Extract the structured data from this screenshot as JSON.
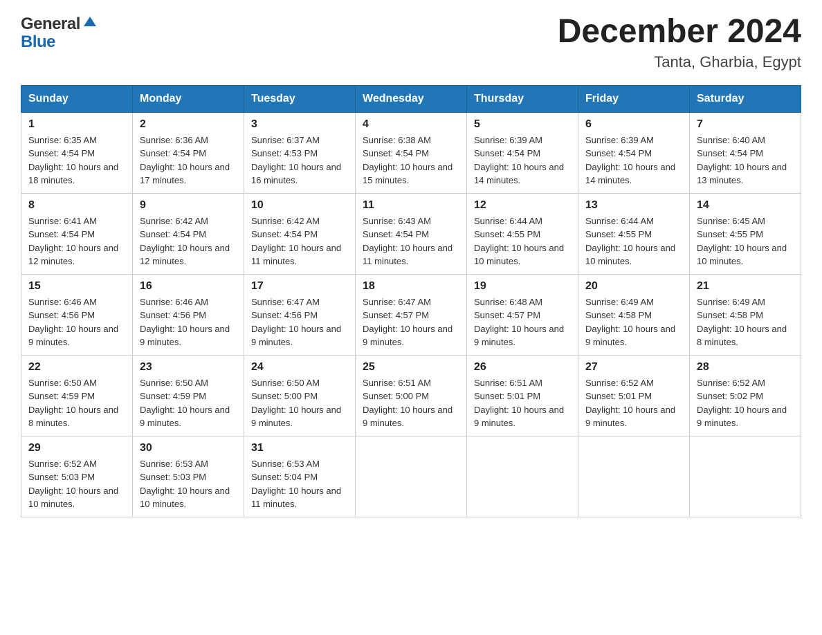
{
  "header": {
    "logo_general": "General",
    "logo_blue": "Blue",
    "month_title": "December 2024",
    "location": "Tanta, Gharbia, Egypt"
  },
  "weekdays": [
    "Sunday",
    "Monday",
    "Tuesday",
    "Wednesday",
    "Thursday",
    "Friday",
    "Saturday"
  ],
  "weeks": [
    [
      {
        "day": "1",
        "sunrise": "Sunrise: 6:35 AM",
        "sunset": "Sunset: 4:54 PM",
        "daylight": "Daylight: 10 hours and 18 minutes."
      },
      {
        "day": "2",
        "sunrise": "Sunrise: 6:36 AM",
        "sunset": "Sunset: 4:54 PM",
        "daylight": "Daylight: 10 hours and 17 minutes."
      },
      {
        "day": "3",
        "sunrise": "Sunrise: 6:37 AM",
        "sunset": "Sunset: 4:53 PM",
        "daylight": "Daylight: 10 hours and 16 minutes."
      },
      {
        "day": "4",
        "sunrise": "Sunrise: 6:38 AM",
        "sunset": "Sunset: 4:54 PM",
        "daylight": "Daylight: 10 hours and 15 minutes."
      },
      {
        "day": "5",
        "sunrise": "Sunrise: 6:39 AM",
        "sunset": "Sunset: 4:54 PM",
        "daylight": "Daylight: 10 hours and 14 minutes."
      },
      {
        "day": "6",
        "sunrise": "Sunrise: 6:39 AM",
        "sunset": "Sunset: 4:54 PM",
        "daylight": "Daylight: 10 hours and 14 minutes."
      },
      {
        "day": "7",
        "sunrise": "Sunrise: 6:40 AM",
        "sunset": "Sunset: 4:54 PM",
        "daylight": "Daylight: 10 hours and 13 minutes."
      }
    ],
    [
      {
        "day": "8",
        "sunrise": "Sunrise: 6:41 AM",
        "sunset": "Sunset: 4:54 PM",
        "daylight": "Daylight: 10 hours and 12 minutes."
      },
      {
        "day": "9",
        "sunrise": "Sunrise: 6:42 AM",
        "sunset": "Sunset: 4:54 PM",
        "daylight": "Daylight: 10 hours and 12 minutes."
      },
      {
        "day": "10",
        "sunrise": "Sunrise: 6:42 AM",
        "sunset": "Sunset: 4:54 PM",
        "daylight": "Daylight: 10 hours and 11 minutes."
      },
      {
        "day": "11",
        "sunrise": "Sunrise: 6:43 AM",
        "sunset": "Sunset: 4:54 PM",
        "daylight": "Daylight: 10 hours and 11 minutes."
      },
      {
        "day": "12",
        "sunrise": "Sunrise: 6:44 AM",
        "sunset": "Sunset: 4:55 PM",
        "daylight": "Daylight: 10 hours and 10 minutes."
      },
      {
        "day": "13",
        "sunrise": "Sunrise: 6:44 AM",
        "sunset": "Sunset: 4:55 PM",
        "daylight": "Daylight: 10 hours and 10 minutes."
      },
      {
        "day": "14",
        "sunrise": "Sunrise: 6:45 AM",
        "sunset": "Sunset: 4:55 PM",
        "daylight": "Daylight: 10 hours and 10 minutes."
      }
    ],
    [
      {
        "day": "15",
        "sunrise": "Sunrise: 6:46 AM",
        "sunset": "Sunset: 4:56 PM",
        "daylight": "Daylight: 10 hours and 9 minutes."
      },
      {
        "day": "16",
        "sunrise": "Sunrise: 6:46 AM",
        "sunset": "Sunset: 4:56 PM",
        "daylight": "Daylight: 10 hours and 9 minutes."
      },
      {
        "day": "17",
        "sunrise": "Sunrise: 6:47 AM",
        "sunset": "Sunset: 4:56 PM",
        "daylight": "Daylight: 10 hours and 9 minutes."
      },
      {
        "day": "18",
        "sunrise": "Sunrise: 6:47 AM",
        "sunset": "Sunset: 4:57 PM",
        "daylight": "Daylight: 10 hours and 9 minutes."
      },
      {
        "day": "19",
        "sunrise": "Sunrise: 6:48 AM",
        "sunset": "Sunset: 4:57 PM",
        "daylight": "Daylight: 10 hours and 9 minutes."
      },
      {
        "day": "20",
        "sunrise": "Sunrise: 6:49 AM",
        "sunset": "Sunset: 4:58 PM",
        "daylight": "Daylight: 10 hours and 9 minutes."
      },
      {
        "day": "21",
        "sunrise": "Sunrise: 6:49 AM",
        "sunset": "Sunset: 4:58 PM",
        "daylight": "Daylight: 10 hours and 8 minutes."
      }
    ],
    [
      {
        "day": "22",
        "sunrise": "Sunrise: 6:50 AM",
        "sunset": "Sunset: 4:59 PM",
        "daylight": "Daylight: 10 hours and 8 minutes."
      },
      {
        "day": "23",
        "sunrise": "Sunrise: 6:50 AM",
        "sunset": "Sunset: 4:59 PM",
        "daylight": "Daylight: 10 hours and 9 minutes."
      },
      {
        "day": "24",
        "sunrise": "Sunrise: 6:50 AM",
        "sunset": "Sunset: 5:00 PM",
        "daylight": "Daylight: 10 hours and 9 minutes."
      },
      {
        "day": "25",
        "sunrise": "Sunrise: 6:51 AM",
        "sunset": "Sunset: 5:00 PM",
        "daylight": "Daylight: 10 hours and 9 minutes."
      },
      {
        "day": "26",
        "sunrise": "Sunrise: 6:51 AM",
        "sunset": "Sunset: 5:01 PM",
        "daylight": "Daylight: 10 hours and 9 minutes."
      },
      {
        "day": "27",
        "sunrise": "Sunrise: 6:52 AM",
        "sunset": "Sunset: 5:01 PM",
        "daylight": "Daylight: 10 hours and 9 minutes."
      },
      {
        "day": "28",
        "sunrise": "Sunrise: 6:52 AM",
        "sunset": "Sunset: 5:02 PM",
        "daylight": "Daylight: 10 hours and 9 minutes."
      }
    ],
    [
      {
        "day": "29",
        "sunrise": "Sunrise: 6:52 AM",
        "sunset": "Sunset: 5:03 PM",
        "daylight": "Daylight: 10 hours and 10 minutes."
      },
      {
        "day": "30",
        "sunrise": "Sunrise: 6:53 AM",
        "sunset": "Sunset: 5:03 PM",
        "daylight": "Daylight: 10 hours and 10 minutes."
      },
      {
        "day": "31",
        "sunrise": "Sunrise: 6:53 AM",
        "sunset": "Sunset: 5:04 PM",
        "daylight": "Daylight: 10 hours and 11 minutes."
      },
      null,
      null,
      null,
      null
    ]
  ]
}
